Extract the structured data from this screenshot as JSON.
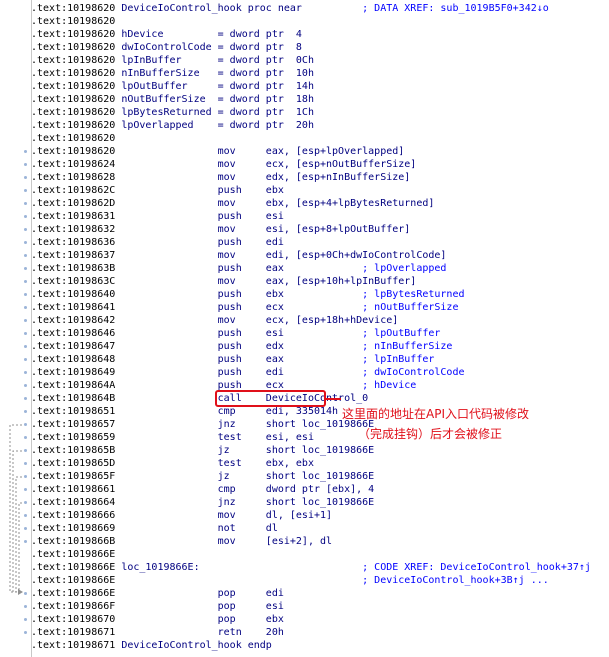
{
  "lines": [
    {
      "addr": ".text:10198620",
      "code": " DeviceIoControl_hook proc near          ",
      "comment": "; DATA XREF: sub_1019B5F0+342↓o",
      "dot": false
    },
    {
      "addr": ".text:10198620",
      "code": "",
      "comment": "",
      "dot": false
    },
    {
      "addr": ".text:10198620",
      "code": " hDevice         = dword ptr  4",
      "comment": "",
      "dot": false
    },
    {
      "addr": ".text:10198620",
      "code": " dwIoControlCode = dword ptr  8",
      "comment": "",
      "dot": false
    },
    {
      "addr": ".text:10198620",
      "code": " lpInBuffer      = dword ptr  0Ch",
      "comment": "",
      "dot": false
    },
    {
      "addr": ".text:10198620",
      "code": " nInBufferSize   = dword ptr  10h",
      "comment": "",
      "dot": false
    },
    {
      "addr": ".text:10198620",
      "code": " lpOutBuffer     = dword ptr  14h",
      "comment": "",
      "dot": false
    },
    {
      "addr": ".text:10198620",
      "code": " nOutBufferSize  = dword ptr  18h",
      "comment": "",
      "dot": false
    },
    {
      "addr": ".text:10198620",
      "code": " lpBytesReturned = dword ptr  1Ch",
      "comment": "",
      "dot": false
    },
    {
      "addr": ".text:10198620",
      "code": " lpOverlapped    = dword ptr  20h",
      "comment": "",
      "dot": false
    },
    {
      "addr": ".text:10198620",
      "code": "",
      "comment": "",
      "dot": false
    },
    {
      "addr": ".text:10198620",
      "code": "                 mov     eax, [esp+lpOverlapped]",
      "comment": "",
      "dot": true
    },
    {
      "addr": ".text:10198624",
      "code": "                 mov     ecx, [esp+nOutBufferSize]",
      "comment": "",
      "dot": true
    },
    {
      "addr": ".text:10198628",
      "code": "                 mov     edx, [esp+nInBufferSize]",
      "comment": "",
      "dot": true
    },
    {
      "addr": ".text:1019862C",
      "code": "                 push    ebx",
      "comment": "",
      "dot": true
    },
    {
      "addr": ".text:1019862D",
      "code": "                 mov     ebx, [esp+4+lpBytesReturned]",
      "comment": "",
      "dot": true
    },
    {
      "addr": ".text:10198631",
      "code": "                 push    esi",
      "comment": "",
      "dot": true
    },
    {
      "addr": ".text:10198632",
      "code": "                 mov     esi, [esp+8+lpOutBuffer]",
      "comment": "",
      "dot": true
    },
    {
      "addr": ".text:10198636",
      "code": "                 push    edi",
      "comment": "",
      "dot": true
    },
    {
      "addr": ".text:10198637",
      "code": "                 mov     edi, [esp+0Ch+dwIoControlCode]",
      "comment": "",
      "dot": true
    },
    {
      "addr": ".text:1019863B",
      "code": "                 push    eax             ",
      "comment": "; lpOverlapped",
      "dot": true
    },
    {
      "addr": ".text:1019863C",
      "code": "                 mov     eax, [esp+10h+lpInBuffer]",
      "comment": "",
      "dot": true
    },
    {
      "addr": ".text:10198640",
      "code": "                 push    ebx             ",
      "comment": "; lpBytesReturned",
      "dot": true
    },
    {
      "addr": ".text:10198641",
      "code": "                 push    ecx             ",
      "comment": "; nOutBufferSize",
      "dot": true
    },
    {
      "addr": ".text:10198642",
      "code": "                 mov     ecx, [esp+18h+hDevice]",
      "comment": "",
      "dot": true
    },
    {
      "addr": ".text:10198646",
      "code": "                 push    esi             ",
      "comment": "; lpOutBuffer",
      "dot": true
    },
    {
      "addr": ".text:10198647",
      "code": "                 push    edx             ",
      "comment": "; nInBufferSize",
      "dot": true
    },
    {
      "addr": ".text:10198648",
      "code": "                 push    eax             ",
      "comment": "; lpInBuffer",
      "dot": true
    },
    {
      "addr": ".text:10198649",
      "code": "                 push    edi             ",
      "comment": "; dwIoControlCode",
      "dot": true
    },
    {
      "addr": ".text:1019864A",
      "code": "                 push    ecx             ",
      "comment": "; hDevice",
      "dot": true
    },
    {
      "addr": ".text:1019864B",
      "code": "                 call    DeviceIoControl_0",
      "comment": "",
      "dot": true
    },
    {
      "addr": ".text:10198651",
      "code": "                 cmp     edi, 335014h",
      "comment": "",
      "dot": true
    },
    {
      "addr": ".text:10198657",
      "code": "                 jnz     short loc_1019866E",
      "comment": "",
      "dot": true
    },
    {
      "addr": ".text:10198659",
      "code": "                 test    esi, esi",
      "comment": "",
      "dot": true
    },
    {
      "addr": ".text:1019865B",
      "code": "                 jz      short loc_1019866E",
      "comment": "",
      "dot": true
    },
    {
      "addr": ".text:1019865D",
      "code": "                 test    ebx, ebx",
      "comment": "",
      "dot": true
    },
    {
      "addr": ".text:1019865F",
      "code": "                 jz      short loc_1019866E",
      "comment": "",
      "dot": true
    },
    {
      "addr": ".text:10198661",
      "code": "                 cmp     dword ptr [ebx], 4",
      "comment": "",
      "dot": true
    },
    {
      "addr": ".text:10198664",
      "code": "                 jnz     short loc_1019866E",
      "comment": "",
      "dot": true
    },
    {
      "addr": ".text:10198666",
      "code": "                 mov     dl, [esi+1]",
      "comment": "",
      "dot": true
    },
    {
      "addr": ".text:10198669",
      "code": "                 not     dl",
      "comment": "",
      "dot": true
    },
    {
      "addr": ".text:1019866B",
      "code": "                 mov     [esi+2], dl",
      "comment": "",
      "dot": true
    },
    {
      "addr": ".text:1019866E",
      "code": "",
      "comment": "",
      "dot": false
    },
    {
      "addr": ".text:1019866E",
      "code": " loc_1019866E:                           ",
      "comment": "; CODE XREF: DeviceIoControl_hook+37↑j",
      "dot": false
    },
    {
      "addr": ".text:1019866E",
      "code": "                                         ",
      "comment": "; DeviceIoControl_hook+3B↑j ...",
      "dot": false
    },
    {
      "addr": ".text:1019866E",
      "code": "                 pop     edi",
      "comment": "",
      "dot": true
    },
    {
      "addr": ".text:1019866F",
      "code": "                 pop     esi",
      "comment": "",
      "dot": true
    },
    {
      "addr": ".text:10198670",
      "code": "                 pop     ebx",
      "comment": "",
      "dot": true
    },
    {
      "addr": ".text:10198671",
      "code": "                 retn    20h",
      "comment": "",
      "dot": true
    },
    {
      "addr": ".text:10198671",
      "code": " DeviceIoControl_hook endp",
      "comment": "",
      "dot": false
    }
  ],
  "annotation": {
    "line1": "这里面的地址在API入口代码被修改",
    "line2": "（完成挂钩）后才会被修正"
  },
  "colors": {
    "highlight": "#e0101a",
    "code": "#000080",
    "comment": "#0000ff"
  }
}
